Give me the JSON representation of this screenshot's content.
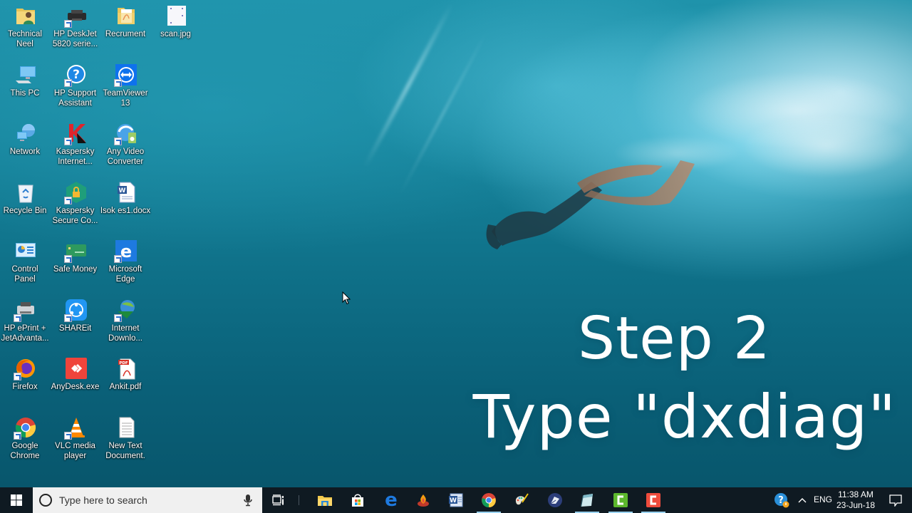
{
  "desktop": {
    "icons": [
      {
        "label": "Technical\nNeel",
        "icon": "user-folder-icon",
        "shortcut": false
      },
      {
        "label": "HP DeskJet\n5820 serie...",
        "icon": "printer-icon",
        "shortcut": true
      },
      {
        "label": "Recrument",
        "icon": "pdf-folder-icon",
        "shortcut": false
      },
      {
        "label": "scan.jpg",
        "icon": "image-file-icon",
        "shortcut": false
      },
      {
        "label": "This PC",
        "icon": "computer-icon",
        "shortcut": false
      },
      {
        "label": "HP Support\nAssistant",
        "icon": "help-icon",
        "shortcut": true
      },
      {
        "label": "TeamViewer\n13",
        "icon": "teamviewer-icon",
        "shortcut": true
      },
      {
        "label": "Network",
        "icon": "network-icon",
        "shortcut": false
      },
      {
        "label": "Kaspersky\nInternet...",
        "icon": "kaspersky-icon",
        "shortcut": true
      },
      {
        "label": "Any Video\nConverter",
        "icon": "video-converter-icon",
        "shortcut": true
      },
      {
        "label": "Recycle Bin",
        "icon": "recycle-bin-icon",
        "shortcut": false
      },
      {
        "label": "Kaspersky\nSecure Co...",
        "icon": "kaspersky-vpn-icon",
        "shortcut": true
      },
      {
        "label": "Isok es1.docx",
        "icon": "word-document-icon",
        "shortcut": false
      },
      {
        "label": "Control\nPanel",
        "icon": "control-panel-icon",
        "shortcut": false
      },
      {
        "label": "Safe Money",
        "icon": "safe-money-icon",
        "shortcut": true
      },
      {
        "label": "Microsoft\nEdge",
        "icon": "edge-icon",
        "shortcut": true
      },
      {
        "label": "HP ePrint +\nJetAdvanta...",
        "icon": "hp-eprint-icon",
        "shortcut": true
      },
      {
        "label": "SHAREit",
        "icon": "shareit-icon",
        "shortcut": true
      },
      {
        "label": "Internet\nDownlo...",
        "icon": "idm-icon",
        "shortcut": true
      },
      {
        "label": "Firefox",
        "icon": "firefox-icon",
        "shortcut": true
      },
      {
        "label": "AnyDesk.exe",
        "icon": "anydesk-icon",
        "shortcut": false
      },
      {
        "label": "Ankit.pdf",
        "icon": "pdf-file-icon",
        "shortcut": false
      },
      {
        "label": "Google\nChrome",
        "icon": "chrome-icon",
        "shortcut": true
      },
      {
        "label": "VLC media\nplayer",
        "icon": "vlc-icon",
        "shortcut": true
      },
      {
        "label": "New Text\nDocument.",
        "icon": "text-document-icon",
        "shortcut": false
      }
    ]
  },
  "overlay": {
    "line1": "Step 2",
    "line2": "Type \"dxdiag\""
  },
  "taskbar": {
    "search_placeholder": "Type here to search",
    "pinned": [
      {
        "name": "task-view",
        "running": false
      },
      {
        "name": "file-explorer",
        "running": false
      },
      {
        "name": "microsoft-store",
        "running": false
      },
      {
        "name": "edge",
        "running": false
      },
      {
        "name": "burning-app",
        "running": false
      },
      {
        "name": "word",
        "running": false
      },
      {
        "name": "chrome",
        "running": true
      },
      {
        "name": "paint",
        "running": false
      },
      {
        "name": "inkscape-like",
        "running": false
      },
      {
        "name": "notepad-like",
        "running": true
      },
      {
        "name": "camtasia-recorder",
        "running": true
      },
      {
        "name": "camtasia-studio",
        "running": true
      }
    ],
    "tray": {
      "language": "ENG",
      "time": "11:38 AM",
      "date": "23-Jun-18"
    }
  },
  "colors": {
    "taskbar_bg": "#0f1a22",
    "search_bg": "#f0f0f0",
    "running_indicator": "#9ad2f0",
    "water": "#0f7189"
  }
}
